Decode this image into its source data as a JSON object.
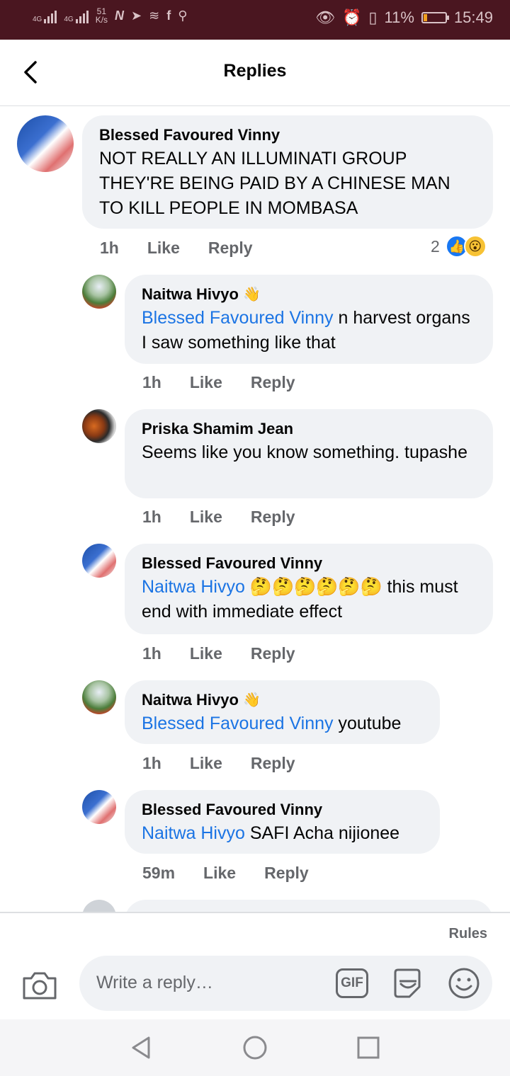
{
  "status_bar": {
    "network_left": "4G",
    "network_right": "4G",
    "speed_value": "51",
    "speed_unit": "K/s",
    "battery": "11%",
    "time": "15:49"
  },
  "header": {
    "title": "Replies"
  },
  "main_comment": {
    "author": "Blessed Favoured Vinny",
    "text": "NOT REALLY AN ILLUMINATI GROUP THEY'RE BEING PAID BY A CHINESE MAN TO KILL PEOPLE IN MOMBASA",
    "time": "1h",
    "like": "Like",
    "reply": "Reply",
    "reaction_count": "2"
  },
  "replies": [
    {
      "author": "Naitwa Hivyo",
      "mention": "Blessed Favoured Vinny",
      "text": " n harvest organs I saw something like that",
      "time": "1h",
      "like": "Like",
      "reply": "Reply"
    },
    {
      "author": "Priska Shamim Jean",
      "mention": "",
      "text": "Seems like you know something. tupashe",
      "time": "1h",
      "like": "Like",
      "reply": "Reply"
    },
    {
      "author": "Blessed Favoured Vinny",
      "mention": "Naitwa Hivyo",
      "text": " 🤔🤔🤔🤔🤔🤔 this must end with immediate effect",
      "time": "1h",
      "like": "Like",
      "reply": "Reply"
    },
    {
      "author": "Naitwa Hivyo",
      "mention": "Blessed Favoured Vinny",
      "text": " youtube",
      "time": "1h",
      "like": "Like",
      "reply": "Reply"
    },
    {
      "author": "Blessed Favoured Vinny",
      "mention": "Naitwa Hivyo",
      "text": " SAFI Acha nijionee",
      "time": "59m",
      "like": "Like",
      "reply": "Reply"
    }
  ],
  "composer": {
    "rules": "Rules",
    "placeholder": "Write a reply…",
    "gif": "GIF"
  }
}
